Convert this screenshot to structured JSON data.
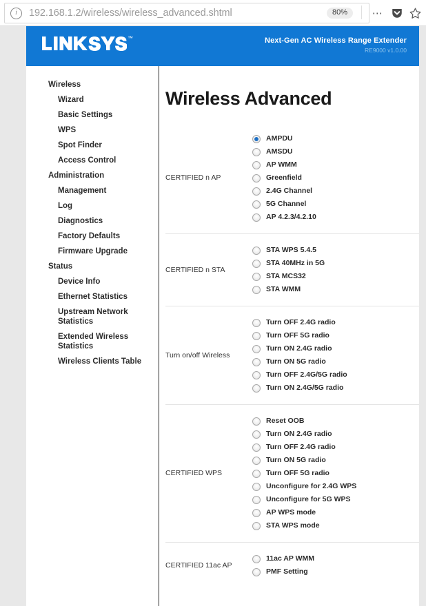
{
  "browser": {
    "url_host": "192.168.1.2",
    "url_path": "/wireless/wireless_advanced.shtml",
    "zoom_level": "80%",
    "info_icon": "info-icon",
    "menu_icon": "more-options-icon",
    "shield_icon": "pocket-icon",
    "star_icon": "bookmark-star-icon"
  },
  "header": {
    "logo_text": "LINKSYS",
    "logo_tm": "™",
    "product_title": "Next-Gen AC Wireless Range Extender",
    "model": "RE9000 v1.0.00",
    "brand_color": "#1178d4"
  },
  "sidebar": {
    "sections": [
      {
        "label": "Wireless",
        "items": [
          "Wizard",
          "Basic Settings",
          "WPS",
          "Spot Finder",
          "Access Control"
        ]
      },
      {
        "label": "Administration",
        "items": [
          "Management",
          "Log",
          "Diagnostics",
          "Factory Defaults",
          "Firmware Upgrade"
        ]
      },
      {
        "label": "Status",
        "items": [
          "Device Info",
          "Ethernet Statistics",
          "Upstream Network Statistics",
          "Extended Wireless Statistics",
          "Wireless Clients Table"
        ]
      }
    ]
  },
  "main": {
    "page_title": "Wireless Advanced",
    "groups": [
      {
        "label": "CERTIFIED n AP",
        "options": [
          {
            "label": "AMPDU",
            "checked": true
          },
          {
            "label": "AMSDU",
            "checked": false
          },
          {
            "label": "AP WMM",
            "checked": false
          },
          {
            "label": "Greenfield",
            "checked": false
          },
          {
            "label": "2.4G Channel",
            "checked": false
          },
          {
            "label": "5G Channel",
            "checked": false
          },
          {
            "label": "AP 4.2.3/4.2.10",
            "checked": false
          }
        ]
      },
      {
        "label": "CERTIFIED n STA",
        "options": [
          {
            "label": "STA WPS 5.4.5",
            "checked": false
          },
          {
            "label": "STA 40MHz in 5G",
            "checked": false
          },
          {
            "label": "STA MCS32",
            "checked": false
          },
          {
            "label": "STA WMM",
            "checked": false
          }
        ]
      },
      {
        "label": "Turn on/off Wireless",
        "options": [
          {
            "label": "Turn OFF 2.4G radio",
            "checked": false
          },
          {
            "label": "Turn OFF 5G radio",
            "checked": false
          },
          {
            "label": "Turn ON 2.4G radio",
            "checked": false
          },
          {
            "label": "Turn ON 5G radio",
            "checked": false
          },
          {
            "label": "Turn OFF 2.4G/5G radio",
            "checked": false
          },
          {
            "label": "Turn ON 2.4G/5G radio",
            "checked": false
          }
        ]
      },
      {
        "label": "CERTIFIED WPS",
        "options": [
          {
            "label": "Reset OOB",
            "checked": false
          },
          {
            "label": "Turn ON 2.4G radio",
            "checked": false
          },
          {
            "label": "Turn OFF 2.4G radio",
            "checked": false
          },
          {
            "label": "Turn ON 5G radio",
            "checked": false
          },
          {
            "label": "Turn OFF 5G radio",
            "checked": false
          },
          {
            "label": "Unconfigure for 2.4G WPS",
            "checked": false
          },
          {
            "label": "Unconfigure for 5G WPS",
            "checked": false
          },
          {
            "label": "AP WPS mode",
            "checked": false
          },
          {
            "label": "STA WPS mode",
            "checked": false
          }
        ]
      },
      {
        "label": "CERTIFIED 11ac AP",
        "options": [
          {
            "label": "11ac AP WMM",
            "checked": false
          },
          {
            "label": "PMF Setting",
            "checked": false
          }
        ]
      }
    ]
  }
}
